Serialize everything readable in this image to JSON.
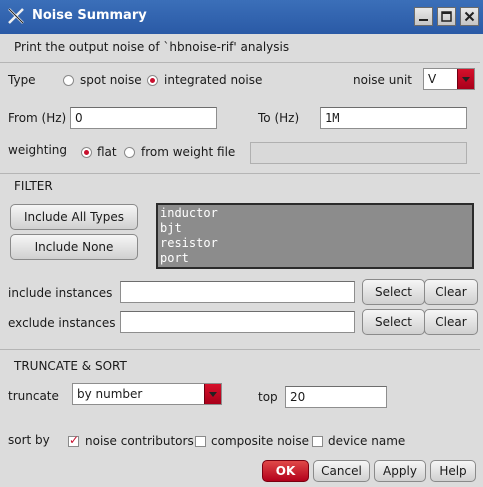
{
  "window": {
    "title": "Noise Summary"
  },
  "header_text": "Print the output noise of `hbnoise-rif' analysis",
  "type_row": {
    "label": "Type",
    "options": [
      {
        "label": "spot noise",
        "selected": false
      },
      {
        "label": "integrated noise",
        "selected": true
      }
    ],
    "unit_label": "noise unit",
    "unit_value": "V"
  },
  "range_row": {
    "from_label": "From (Hz)",
    "from_value": "0",
    "to_label": "To (Hz)",
    "to_value": "1M"
  },
  "weighting_row": {
    "label": "weighting",
    "options": [
      {
        "label": "flat",
        "selected": true
      },
      {
        "label": "from weight file",
        "selected": false
      }
    ],
    "file_value": ""
  },
  "filter": {
    "section_label": "FILTER",
    "include_all_label": "Include All Types",
    "include_none_label": "Include None",
    "types": [
      "inductor",
      "bjt",
      "resistor",
      "port"
    ],
    "include_label": "include instances",
    "include_value": "",
    "exclude_label": "exclude instances",
    "exclude_value": "",
    "select_label": "Select",
    "clear_label": "Clear"
  },
  "truncate": {
    "section_label": "TRUNCATE & SORT",
    "truncate_label": "truncate",
    "truncate_value": "by number",
    "top_label": "top",
    "top_value": "20",
    "sort_label": "sort by",
    "sort_options": [
      {
        "label": "noise contributors",
        "checked": true
      },
      {
        "label": "composite noise",
        "checked": false
      },
      {
        "label": "device name",
        "checked": false
      }
    ]
  },
  "footer": {
    "ok": "OK",
    "cancel": "Cancel",
    "apply": "Apply",
    "help": "Help"
  },
  "colors": {
    "titlebar": "#2f63ad",
    "accent": "#c8102e",
    "background": "#dcdcdc"
  },
  "icons": {
    "app": "x-logo-icon",
    "minimize": "minimize-icon",
    "maximize": "maximize-icon",
    "close": "close-icon"
  }
}
